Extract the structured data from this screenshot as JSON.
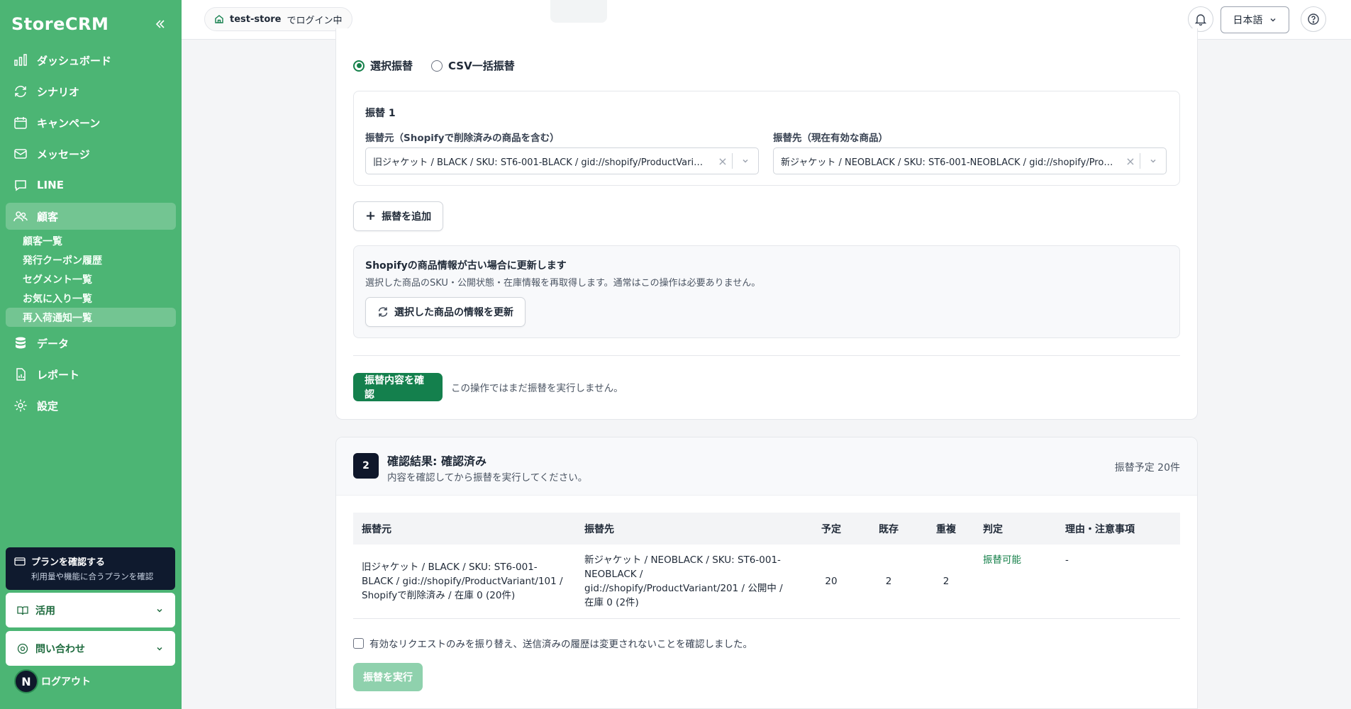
{
  "app": {
    "brand": "StoreCRM"
  },
  "nav": {
    "items": [
      {
        "label": "ダッシュボード",
        "icon": "bar-chart-icon"
      },
      {
        "label": "シナリオ",
        "icon": "refresh-icon"
      },
      {
        "label": "キャンペーン",
        "icon": "calendar-icon"
      },
      {
        "label": "メッセージ",
        "icon": "mail-icon"
      },
      {
        "label": "LINE",
        "icon": "chat-icon"
      },
      {
        "label": "顧客",
        "icon": "users-icon"
      },
      {
        "label": "データ",
        "icon": "database-icon"
      },
      {
        "label": "レポート",
        "icon": "report-icon"
      },
      {
        "label": "設定",
        "icon": "gear-icon"
      }
    ],
    "customer_sub": [
      "顧客一覧",
      "発行クーポン履歴",
      "セグメント一覧",
      "お気に入り一覧",
      "再入荷通知一覧"
    ]
  },
  "sidebar_bottom": {
    "plan_title": "プランを確認する",
    "plan_sub": "利用量や機能に合うプランを確認",
    "usage": "活用",
    "contact": "問い合わせ",
    "logout": "ログアウト",
    "avatar_initial": "N"
  },
  "header": {
    "store": "test-store",
    "store_suffix": "でログイン中",
    "language": "日本語"
  },
  "form": {
    "mode_selected": "選択振替",
    "mode_csv": "CSV一括振替",
    "transfer_title": "振替 1",
    "source_label": "振替元（Shopifyで削除済みの商品を含む）",
    "source_value": "旧ジャケット / BLACK / SKU: ST6-001-BLACK / gid://shopify/ProductVariant/101 / Shopifyで削除済み / 在庫 0 (20件)",
    "target_label": "振替先（現在有効な商品）",
    "target_value": "新ジャケット / NEOBLACK / SKU: ST6-001-NEOBLACK / gid://shopify/ProductVariant/201 / 公開中 / 在庫 0 (2件)",
    "add_button": "振替を追加",
    "refresh_title": "Shopifyの商品情報が古い場合に更新します",
    "refresh_desc": "選択した商品のSKU・公開状態・在庫情報を再取得します。通常はこの操作は必要ありません。",
    "refresh_button": "選択した商品の情報を更新",
    "confirm_button": "振替内容を確認",
    "confirm_hint": "この操作ではまだ振替を実行しません。"
  },
  "result": {
    "step": "2",
    "title": "確認結果: 確認済み",
    "subtitle": "内容を確認してから振替を実行してください。",
    "count": "振替予定 20件",
    "columns": [
      "振替元",
      "振替先",
      "予定",
      "既存",
      "重複",
      "判定",
      "理由・注意事項"
    ],
    "rows": [
      {
        "source": "旧ジャケット / BLACK / SKU: ST6-001-BLACK / gid://shopify/ProductVariant/101 / Shopifyで削除済み / 在庫 0 (20件)",
        "target": "新ジャケット / NEOBLACK / SKU: ST6-001-NEOBLACK / gid://shopify/ProductVariant/201 / 公開中 / 在庫 0 (2件)",
        "planned": "20",
        "existing": "2",
        "duplicate": "2",
        "verdict": "振替可能",
        "reason": "-"
      }
    ],
    "checkbox_label": "有効なリクエストのみを振り替え、送信済みの履歴は変更されないことを確認しました。",
    "execute_button": "振替を実行"
  },
  "colors": {
    "sidebar": "#4cb574",
    "primary": "#14804d",
    "dark": "#0f172a"
  }
}
